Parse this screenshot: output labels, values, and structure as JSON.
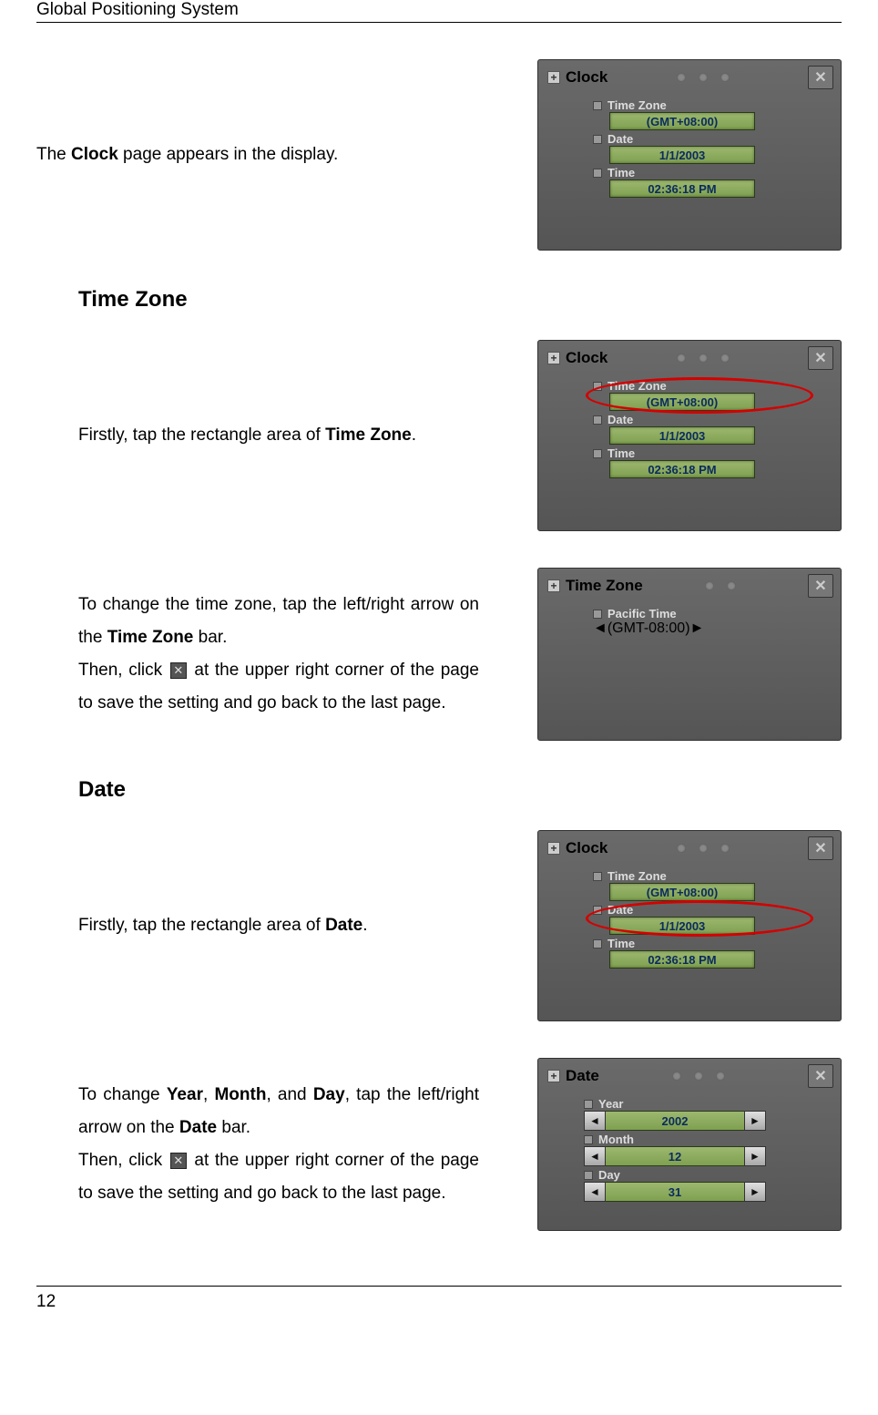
{
  "header": "Global Positioning System",
  "page_number": "12",
  "intro": {
    "prefix": "The ",
    "bold": "Clock",
    "suffix": " page appears in the display."
  },
  "sections": {
    "timezone": {
      "heading": "Time Zone",
      "p1_prefix": "Firstly, tap the rectangle area of ",
      "p1_bold": "Time Zone",
      "p1_suffix": ".",
      "p2_line1_a": "To change the time zone, tap the left/right arrow on the ",
      "p2_line1_bold": "Time Zone",
      "p2_line1_b": " bar.",
      "p2_line2_a": "Then, click ",
      "p2_line2_b": " at the upper right corner of the page to save the setting and go back to the last page."
    },
    "date": {
      "heading": "Date",
      "p1_prefix": "Firstly, tap the rectangle area of ",
      "p1_bold": "Date",
      "p1_suffix": ".",
      "p2_a": "To change ",
      "p2_b1": "Year",
      "p2_c": ", ",
      "p2_b2": "Month",
      "p2_d": ", and ",
      "p2_b3": "Day",
      "p2_e": ", tap the left/right arrow on the ",
      "p2_b4": "Date",
      "p2_f": " bar.",
      "p2_g": "Then, click ",
      "p2_h": " at the upper right corner of the page to save the setting and go back to the last page."
    }
  },
  "device": {
    "clock_title": "Clock",
    "timezone_title": "Time Zone",
    "date_title": "Date",
    "labels": {
      "timezone": "Time Zone",
      "date": "Date",
      "time": "Time",
      "pacific": "Pacific Time",
      "year": "Year",
      "month": "Month",
      "day": "Day"
    },
    "values": {
      "gmt_plus8": "(GMT+08:00)",
      "gmt_minus8": "(GMT-08:00)",
      "date1": "1/1/2003",
      "time1": "02:36:18 PM",
      "year": "2002",
      "month": "12",
      "day": "31"
    },
    "close": "✕",
    "plus": "+",
    "left": "◄",
    "right": "►"
  }
}
